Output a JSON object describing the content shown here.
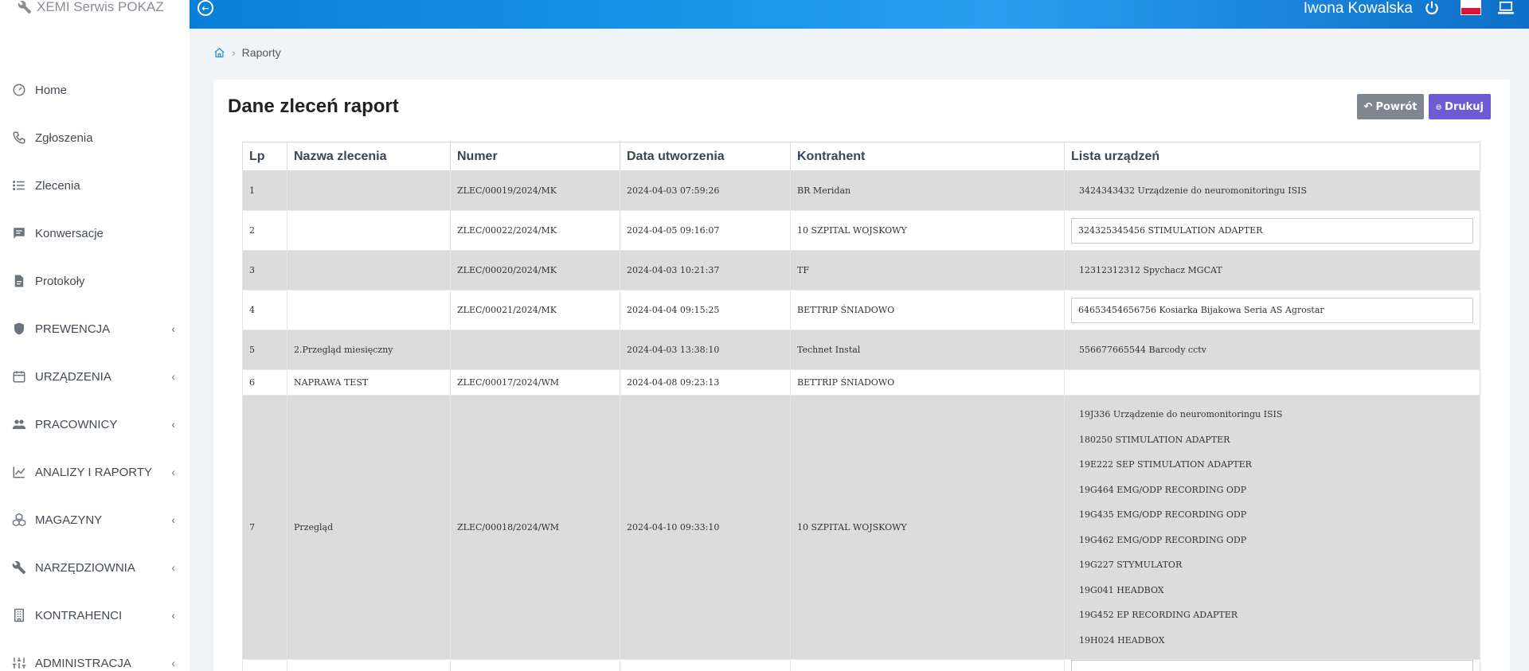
{
  "app": {
    "brand": "XEMI Serwis POKAZ"
  },
  "header": {
    "user": "Iwona Kowalska"
  },
  "sidebar": {
    "items": [
      {
        "label": "Home",
        "icon": "dashboard-icon",
        "submenu": false
      },
      {
        "label": "Zgłoszenia",
        "icon": "phone-icon",
        "submenu": false
      },
      {
        "label": "Zlecenia",
        "icon": "list-icon",
        "submenu": false
      },
      {
        "label": "Konwersacje",
        "icon": "chat-icon",
        "submenu": false
      },
      {
        "label": "Protokoły",
        "icon": "document-icon",
        "submenu": false
      },
      {
        "label": "PREWENCJA",
        "icon": "shield-icon",
        "submenu": true
      },
      {
        "label": "URZĄDZENIA",
        "icon": "calendar-icon",
        "submenu": true
      },
      {
        "label": "PRACOWNICY",
        "icon": "users-icon",
        "submenu": true
      },
      {
        "label": "ANALIZY I RAPORTY",
        "icon": "chart-line-icon",
        "submenu": true
      },
      {
        "label": "MAGAZYNY",
        "icon": "cubes-icon",
        "submenu": true
      },
      {
        "label": "NARZĘDZIOWNIA",
        "icon": "wrench-icon",
        "submenu": true
      },
      {
        "label": "KONTRAHENCI",
        "icon": "building-icon",
        "submenu": true
      },
      {
        "label": "ADMINISTRACJA",
        "icon": "sliders-icon",
        "submenu": true
      }
    ]
  },
  "breadcrumb": {
    "current": "Raporty"
  },
  "page": {
    "title": "Dane zleceń raport",
    "back_label": "Powrót",
    "print_label": "Drukuj"
  },
  "table": {
    "headers": [
      "Lp",
      "Nazwa zlecenia",
      "Numer",
      "Data utworzenia",
      "Kontrahent",
      "Lista urządzeń"
    ],
    "rows": [
      {
        "lp": "1",
        "name": "",
        "number": "ZLEC/00019/2024/MK",
        "date": "2024-04-03 07:59:26",
        "client": "BR Meridan",
        "devices": [
          "3424343432 Urządzenie do neuromonitoringu ISIS"
        ]
      },
      {
        "lp": "2",
        "name": "",
        "number": "ZLEC/00022/2024/MK",
        "date": "2024-04-05 09:16:07",
        "client": "10 SZPITAL WOJSKOWY",
        "devices": [
          "324325345456 STIMULATION ADAPTER"
        ]
      },
      {
        "lp": "3",
        "name": "",
        "number": "ZLEC/00020/2024/MK",
        "date": "2024-04-03 10:21:37",
        "client": "TF",
        "devices": [
          "12312312312 Spychacz MGCAT"
        ]
      },
      {
        "lp": "4",
        "name": "",
        "number": "ZLEC/00021/2024/MK",
        "date": "2024-04-04 09:15:25",
        "client": "BETTRIP ŚNIADOWO",
        "devices": [
          "64653454656756 Kosiarka Bijakowa Seria AS Agrostar"
        ]
      },
      {
        "lp": "5",
        "name": "2.Przegląd miesięczny",
        "number": "",
        "date": "2024-04-03 13:38:10",
        "client": "Technet Instal",
        "devices": [
          "556677665544 Barcody cctv"
        ]
      },
      {
        "lp": "6",
        "name": "NAPRAWA TEST",
        "number": "ZLEC/00017/2024/WM",
        "date": "2024-04-08 09:23:13",
        "client": "BETTRIP ŚNIADOWO",
        "devices": []
      },
      {
        "lp": "7",
        "name": "Przegląd",
        "number": "ZLEC/00018/2024/WM",
        "date": "2024-04-10 09:33:10",
        "client": "10 SZPITAL WOJSKOWY",
        "devices": [
          "19J336 Urządzenie do neuromonitoringu ISIS",
          "180250 STIMULATION ADAPTER",
          "19E222 SEP STIMULATION ADAPTER",
          "19G464 EMG/ODP RECORDING ODP",
          "19G435 EMG/ODP RECORDING ODP",
          "19G462 EMG/ODP RECORDING ODP",
          "19G227 STYMULATOR",
          "19G041 HEADBOX",
          "19G452 EP RECORDING ADAPTER",
          "19H024 HEADBOX"
        ]
      }
    ]
  }
}
